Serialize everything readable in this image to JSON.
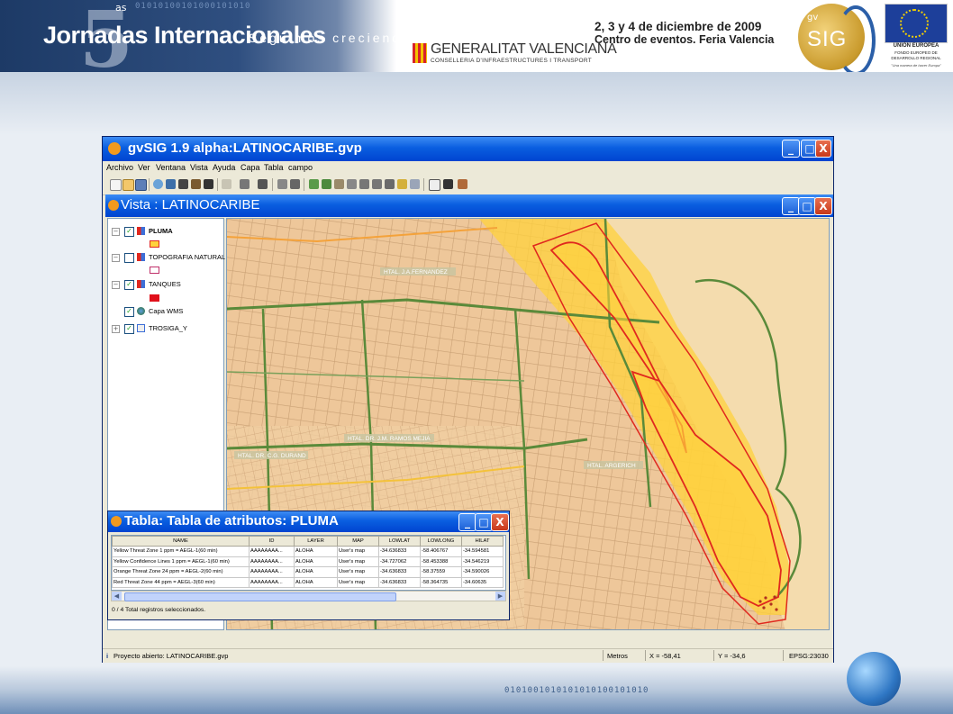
{
  "slide": {
    "event_title": "Jornadas Internacionales",
    "event_edition": "5",
    "event_edition_suffix": "as",
    "tagline": "Seguimos creciendo",
    "sponsor_name": "GENERALITAT VALENCIANA",
    "sponsor_department": "CONSELLERIA D'INFRAESTRUCTURES I TRANSPORT",
    "dates": "2, 3 y 4 de diciembre de 2009",
    "venue": "Centro de eventos. Feria Valencia",
    "gvsig_logo_top": "gv",
    "gvsig_logo_main": "SIG",
    "eu_label": "UNIÓN EUROPEA",
    "eu_fund": "FONDO EUROPEO DE DESARROLLO REGIONAL",
    "eu_motto": "\"Una manera de hacer Europa\"",
    "digits_top": "01010100101000101010",
    "digits_bottom": "0101001010101010100101010"
  },
  "app": {
    "title": "gvSIG 1.9 alpha:LATINOCARIBE.gvp",
    "menu": [
      "Archivo",
      "Ver",
      "Ventana",
      "Vista",
      "Ayuda",
      "Capa",
      "Tabla",
      "campo"
    ],
    "window_buttons": {
      "minimize": "_",
      "maximize": "□",
      "close": "X"
    }
  },
  "view": {
    "title": "Vista : LATINOCARIBE",
    "layers": [
      {
        "name": "PLUMA",
        "checked": true,
        "expanded": true,
        "bold": true
      },
      {
        "name": "TOPOGRAFIA NATURAL",
        "checked": false,
        "expanded": true,
        "bold": false
      },
      {
        "name": "TANQUES",
        "checked": true,
        "expanded": true,
        "bold": false
      },
      {
        "name": "Capa WMS",
        "checked": true,
        "expanded": false,
        "bold": false
      },
      {
        "name": "TROSIGA_Y",
        "checked": true,
        "expanded": true,
        "bold": false
      }
    ],
    "map_labels": [
      "HTAL. J.A.FERNANDEZ",
      "HTAL. DR. C.G. DURAND",
      "HTAL. DR. J.M. RAMOS MEJIA",
      "HTAL. ARGERICH"
    ]
  },
  "attribute_table": {
    "title": "Tabla: Tabla de atributos: PLUMA",
    "columns": [
      "NAME",
      "ID",
      "LAYER",
      "MAP",
      "LOWLAT",
      "LOWLONG",
      "HILAT"
    ],
    "rows": [
      [
        "Yellow Threat Zone 1 ppm = AEGL-1(60 min)",
        "AAAAAAAA...",
        "ALOHA",
        "User's map",
        "-34.636833",
        "-58.406767",
        "-34.594581"
      ],
      [
        "Yellow Confidence Lines 1 ppm = AEGL-1(60 min)",
        "AAAAAAAA...",
        "ALOHA",
        "User's map",
        "-34.727062",
        "-58.453388",
        "-34.546219"
      ],
      [
        "Orange Threat Zone 24 ppm = AEGL-2(60 min)",
        "AAAAAAAA...",
        "ALOHA",
        "User's map",
        "-34.636833",
        "-58.37559",
        "-34.590026"
      ],
      [
        "Red Threat Zone 44 ppm = AEGL-3(60 min)",
        "AAAAAAAA...",
        "ALOHA",
        "User's map",
        "-34.636833",
        "-58.364735",
        "-34.60635"
      ]
    ],
    "status": "0 / 4 Total registros seleccionados."
  },
  "statusbar": {
    "message": "Proyecto abierto: LATINOCARIBE.gvp",
    "units": "Metros",
    "x": "X = -58,41",
    "y": "Y = -34,6",
    "crs": "EPSG:23030"
  },
  "colors": {
    "xp_blue": "#0a5ee0",
    "map_base": "#f1cfa6",
    "plume_yellow": "#ffd23c",
    "plume_red": "#e0281e",
    "roads_green": "#5a8a3a"
  }
}
